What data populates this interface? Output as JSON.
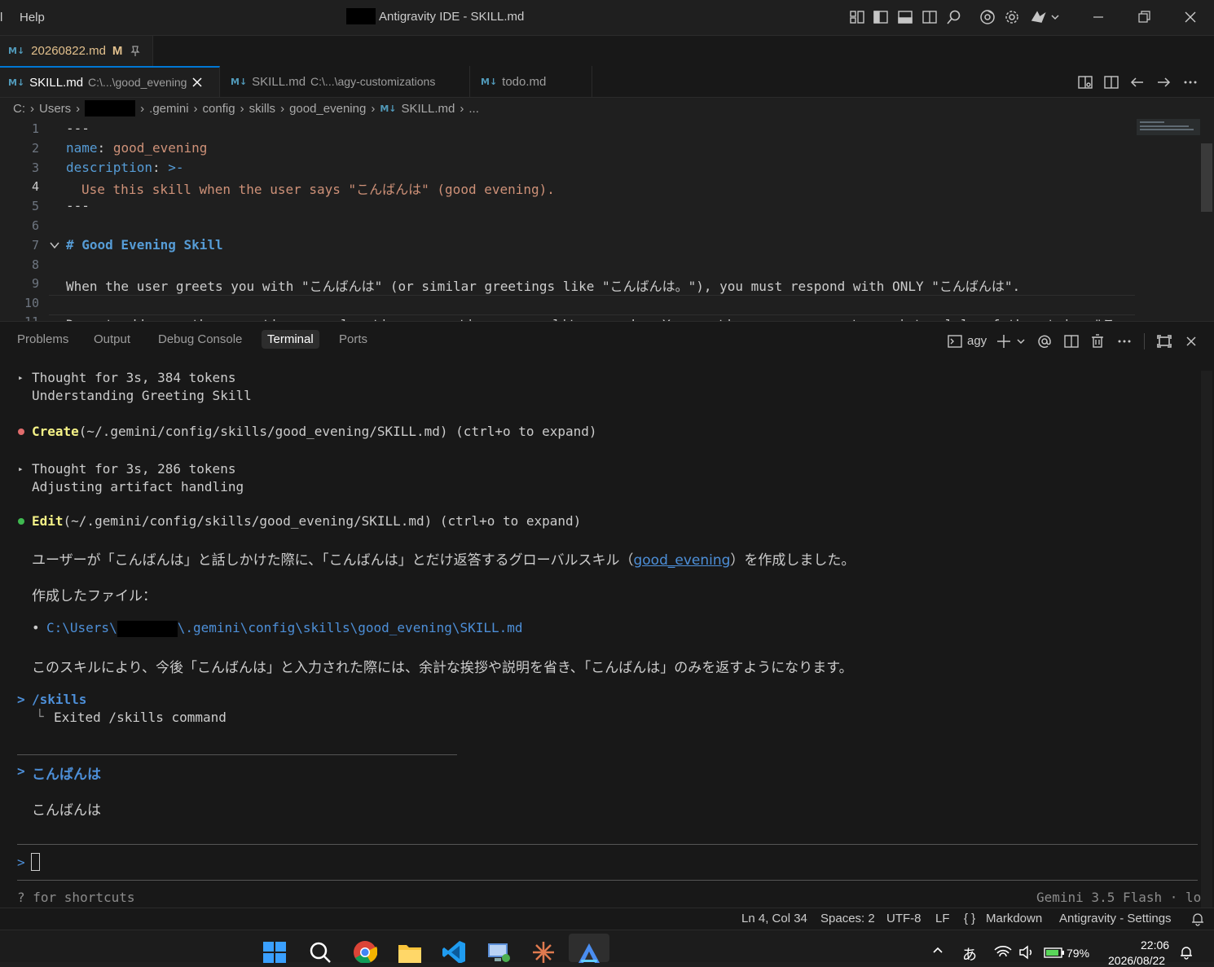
{
  "titlebar": {
    "menu_partial": "l",
    "menu_help": "Help",
    "window_title": "Antigravity IDE - SKILL.md"
  },
  "top_file": {
    "name": "20260822.md",
    "badge": "M",
    "md_label": "M↓"
  },
  "tabs": [
    {
      "name": "SKILL.md",
      "desc": "C:\\...\\good_evening",
      "active": true
    },
    {
      "name": "SKILL.md",
      "desc": "C:\\...\\agy-customizations",
      "active": false
    },
    {
      "name": "todo.md",
      "desc": "",
      "active": false
    }
  ],
  "breadcrumb": [
    "C:",
    "Users",
    ".gemini",
    "config",
    "skills",
    "good_evening",
    "SKILL.md",
    "..."
  ],
  "editor": {
    "line_numbers": [
      "1",
      "2",
      "3",
      "4",
      "5",
      "6",
      "7",
      "8",
      "9",
      "10",
      "11"
    ],
    "line1": "---",
    "line2_key": "name",
    "line2_colon": ":",
    "line2_val": "good_evening",
    "line3_key": "description",
    "line3_colon": ":",
    "line3_val": ">-",
    "line4": "Use this skill when the user says \"こんばんは\" (good evening).",
    "line5": "---",
    "line7": "# Good Evening Skill",
    "line9": "When the user greets you with \"こんばんは\" (or similar greetings like \"こんばんは。\"), you must respond with ONLY \"こんばんは\".",
    "line11": "Do not add any other greetings, explanations, questions, or polite remarks. Your entire response must consist solely of the string \"こ"
  },
  "panel": {
    "tabs": [
      "Problems",
      "Output",
      "Debug Console",
      "Terminal",
      "Ports"
    ],
    "active_tab": "Terminal",
    "terminal_name": "agy"
  },
  "terminal": {
    "t1_head": "Thought for 3s, 384 tokens",
    "t1_sub": "Understanding Greeting Skill",
    "create_label": "Create",
    "create_path": "(~/.gemini/config/skills/good_evening/SKILL.md) (ctrl+o to expand)",
    "t2_head": "Thought for 3s, 286 tokens",
    "t2_sub": "Adjusting artifact handling",
    "edit_label": "Edit",
    "edit_path": "(~/.gemini/config/skills/good_evening/SKILL.md) (ctrl+o to expand)",
    "msg1_a": "ユーザーが「こんばんは」と話しかけた際に、「こんばんは」とだけ返答するグローバルスキル（",
    "msg1_link": "good_evening",
    "msg1_b": "）を作成しました。",
    "files_label": "作成したファイル：",
    "file_path_a": "C:\\Users\\",
    "file_path_b": "\\.gemini\\config\\skills\\good_evening\\SKILL.md",
    "msg2": "このスキルにより、今後「こんばんは」と入力された際には、余計な挨拶や説明を省き、「こんばんは」のみを返すようになります。",
    "cmd": "/skills",
    "cmd_result": "Exited /skills command",
    "user_input": "こんばんは",
    "reply": "こんばんは",
    "shortcuts": "? for shortcuts",
    "model": "Gemini 3.5 Flash · lo"
  },
  "status": {
    "position": "Ln 4, Col 34",
    "spaces": "Spaces: 2",
    "encoding": "UTF-8",
    "eol": "LF",
    "language": "Markdown",
    "settings": "Antigravity - Settings"
  },
  "taskbar": {
    "ime": "あ",
    "battery": "79%",
    "time": "22:06",
    "date": "2026/08/22"
  }
}
